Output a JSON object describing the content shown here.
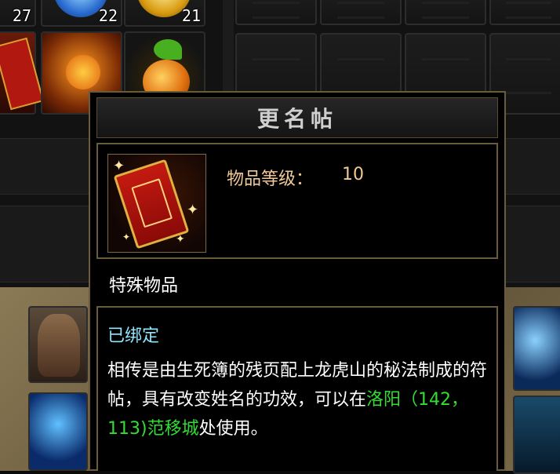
{
  "inventory": {
    "stack_counts": [
      "27",
      "22",
      "21"
    ]
  },
  "tooltip": {
    "title": "更名帖",
    "level_label": "物品等级：",
    "level_value": "10",
    "category": "特殊物品",
    "bound_status": "已绑定",
    "description_before": "相传是由生死簿的残页配上龙虎山的秘法制成的符帖，具有改变姓名的功效，可以在",
    "location": "洛阳（142，113)范移城",
    "description_after": "处使用。"
  },
  "colors": {
    "title_text": "#cfcfcf",
    "level_text": "#f1c898",
    "bound_text": "#8fe6ff",
    "location_text": "#33dd33",
    "border": "#6b5a3c"
  }
}
